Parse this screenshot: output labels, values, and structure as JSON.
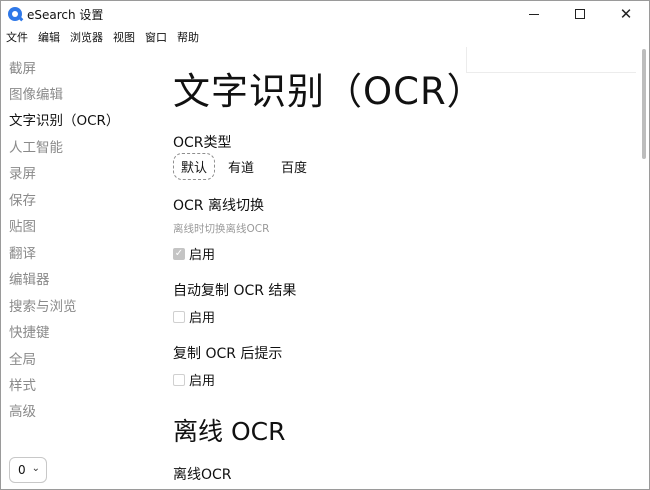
{
  "window": {
    "title": "eSearch 设置"
  },
  "menu": [
    "文件",
    "编辑",
    "浏览器",
    "视图",
    "窗口",
    "帮助"
  ],
  "sidebar": {
    "items": [
      {
        "label": "截屏"
      },
      {
        "label": "图像编辑"
      },
      {
        "label": "文字识别（OCR）",
        "active": true
      },
      {
        "label": "人工智能"
      },
      {
        "label": "录屏"
      },
      {
        "label": "保存"
      },
      {
        "label": "贴图"
      },
      {
        "label": "翻译"
      },
      {
        "label": "编辑器"
      },
      {
        "label": "搜索与浏览"
      },
      {
        "label": "快捷键"
      },
      {
        "label": "全局"
      },
      {
        "label": "样式"
      },
      {
        "label": "高级"
      }
    ],
    "select_value": "0"
  },
  "main": {
    "title": "文字识别（OCR）",
    "ocr_type": {
      "label": "OCR类型",
      "options": [
        "默认",
        "有道",
        "百度"
      ],
      "selected": "默认"
    },
    "offline_switch": {
      "label": "OCR 离线切换",
      "hint": "离线时切换离线OCR",
      "checkbox_label": "启用",
      "checked": true
    },
    "auto_copy": {
      "label": "自动复制 OCR 结果",
      "checkbox_label": "启用",
      "checked": false
    },
    "copy_prompt": {
      "label": "复制 OCR 后提示",
      "checkbox_label": "启用",
      "checked": false
    },
    "offline_section": {
      "heading": "离线 OCR",
      "label": "离线OCR"
    }
  },
  "colors": {
    "accent": "#2f78e8",
    "text": "#111111",
    "muted": "#8a8a8a",
    "checkbox_checked": "#c4c4c4"
  }
}
